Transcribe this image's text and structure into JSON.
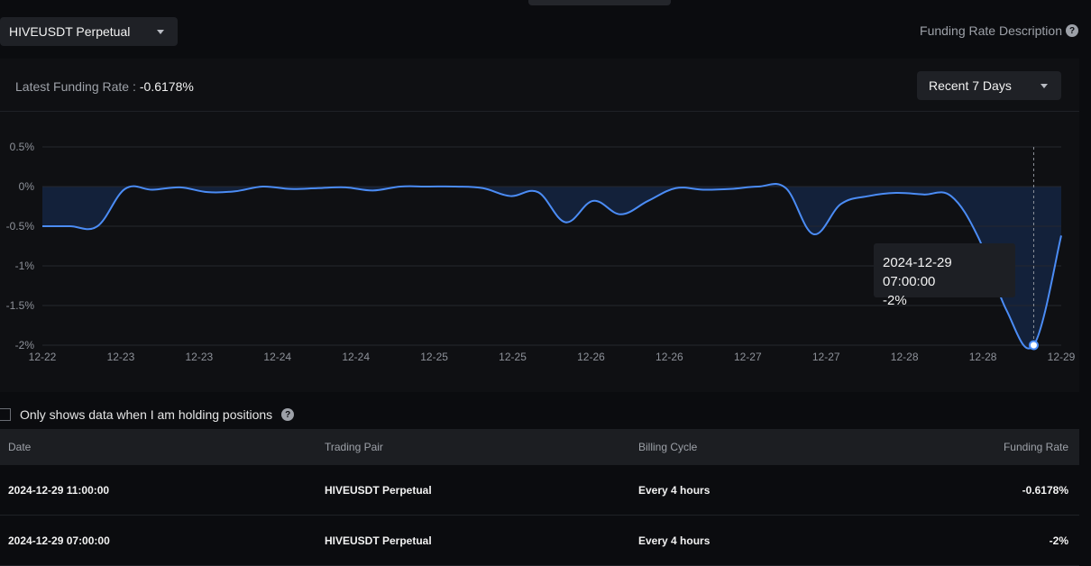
{
  "header": {
    "pair_select": "HIVEUSDT Perpetual",
    "description_link": "Funding Rate Description",
    "help_glyph": "?"
  },
  "summary": {
    "latest_label": "Latest Funding Rate :",
    "latest_value": "-0.6178%",
    "range_select": "Recent 7 Days"
  },
  "tooltip": {
    "date": "2024-12-29 07:00:00",
    "value": "-2%"
  },
  "filter": {
    "holding_label": "Only shows data when I am holding positions",
    "checked": false
  },
  "table": {
    "headers": [
      "Date",
      "Trading Pair",
      "Billing Cycle",
      "Funding Rate"
    ],
    "rows": [
      [
        "2024-12-29 11:00:00",
        "HIVEUSDT Perpetual",
        "Every 4 hours",
        "-0.6178%"
      ],
      [
        "2024-12-29 07:00:00",
        "HIVEUSDT Perpetual",
        "Every 4 hours",
        "-2%"
      ]
    ]
  },
  "colors": {
    "line": "#4b8cf5",
    "area": "#13213a",
    "grid": "#24272d"
  },
  "chart_data": {
    "type": "area",
    "ylim": [
      -2,
      0.5
    ],
    "yticks": [
      0.5,
      0,
      -0.5,
      -1,
      -1.5,
      -2
    ],
    "ytick_labels": [
      "0.5%",
      "0%",
      "-0.5%",
      "-1%",
      "-1.5%",
      "-2%"
    ],
    "xtick_labels": [
      "12-22",
      "12-23",
      "12-23",
      "12-24",
      "12-24",
      "12-25",
      "12-25",
      "12-26",
      "12-26",
      "12-27",
      "12-27",
      "12-28",
      "12-28",
      "12-29"
    ],
    "series": [
      {
        "values": [
          -0.5,
          -0.5,
          -0.5,
          -0.03,
          -0.04,
          -0.01,
          -0.07,
          -0.06,
          0.0,
          -0.03,
          -0.02,
          -0.01,
          -0.05,
          0.0,
          0.0,
          0.0,
          -0.02,
          -0.12,
          -0.07,
          -0.45,
          -0.18,
          -0.35,
          -0.18,
          -0.02,
          -0.04,
          -0.03,
          0.0,
          -0.02,
          -0.6,
          -0.22,
          -0.12,
          -0.08,
          -0.1,
          -0.12,
          -0.65,
          -1.55,
          -2.0,
          -0.6178
        ]
      }
    ],
    "highlight": {
      "index": 36,
      "label": "2024-12-29 07:00:00",
      "value": -2
    }
  }
}
